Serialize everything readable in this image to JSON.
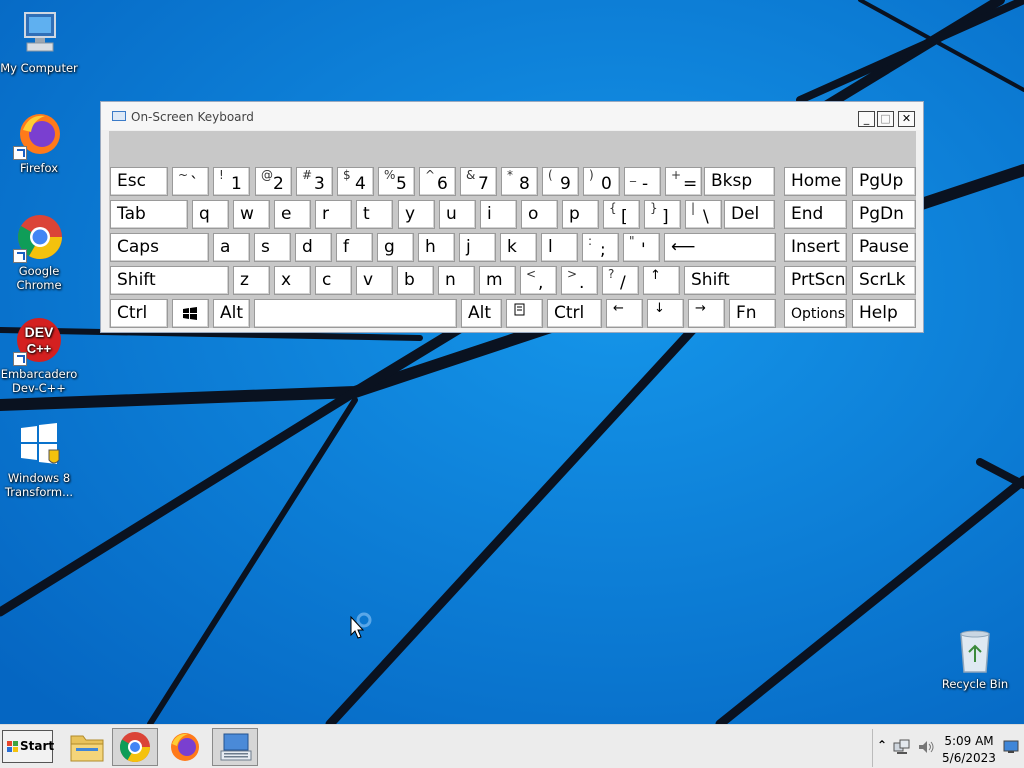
{
  "desktop_icons": [
    {
      "label": "My Computer",
      "icon": "computer-icon"
    },
    {
      "label": "Firefox",
      "icon": "firefox-icon"
    },
    {
      "label": "Google Chrome",
      "icon": "chrome-icon"
    },
    {
      "label": "Embarcadero Dev-C++",
      "icon": "devcpp-icon"
    },
    {
      "label": "Windows 8 Transform...",
      "icon": "windows-logo-icon"
    },
    {
      "label": "Recycle Bin",
      "icon": "recycle-bin-icon"
    }
  ],
  "osk": {
    "title": "On-Screen Keyboard",
    "minimize": "_",
    "maximize": "□",
    "close": "✕",
    "rows": [
      [
        {
          "label": "Esc"
        },
        {
          "alt": "~",
          "label": "`"
        },
        {
          "alt": "!",
          "label": "1"
        },
        {
          "alt": "@",
          "label": "2"
        },
        {
          "alt": "#",
          "label": "3"
        },
        {
          "alt": "$",
          "label": "4"
        },
        {
          "alt": "%",
          "label": "5"
        },
        {
          "alt": "^",
          "label": "6"
        },
        {
          "alt": "&",
          "label": "7"
        },
        {
          "alt": "*",
          "label": "8"
        },
        {
          "alt": "(",
          "label": "9"
        },
        {
          "alt": ")",
          "label": "0"
        },
        {
          "alt": "_",
          "label": "-"
        },
        {
          "alt": "+",
          "label": "="
        },
        {
          "label": "Bksp"
        },
        {
          "label": "Home"
        },
        {
          "label": "PgUp"
        }
      ],
      [
        {
          "label": "Tab"
        },
        {
          "label": "q"
        },
        {
          "label": "w"
        },
        {
          "label": "e"
        },
        {
          "label": "r"
        },
        {
          "label": "t"
        },
        {
          "label": "y"
        },
        {
          "label": "u"
        },
        {
          "label": "i"
        },
        {
          "label": "o"
        },
        {
          "label": "p"
        },
        {
          "alt": "{",
          "label": "["
        },
        {
          "alt": "}",
          "label": "]"
        },
        {
          "alt": "|",
          "label": "\\"
        },
        {
          "label": "Del"
        },
        {
          "label": "End"
        },
        {
          "label": "PgDn"
        }
      ],
      [
        {
          "label": "Caps"
        },
        {
          "label": "a"
        },
        {
          "label": "s"
        },
        {
          "label": "d"
        },
        {
          "label": "f"
        },
        {
          "label": "g"
        },
        {
          "label": "h"
        },
        {
          "label": "j"
        },
        {
          "label": "k"
        },
        {
          "label": "l"
        },
        {
          "alt": ":",
          "label": ";"
        },
        {
          "alt": "\"",
          "label": "'"
        },
        {
          "label": "⟵"
        },
        {
          "label": "Insert"
        },
        {
          "label": "Pause"
        }
      ],
      [
        {
          "label": "Shift"
        },
        {
          "label": "z"
        },
        {
          "label": "x"
        },
        {
          "label": "c"
        },
        {
          "label": "v"
        },
        {
          "label": "b"
        },
        {
          "label": "n"
        },
        {
          "label": "m"
        },
        {
          "alt": "<",
          "label": ","
        },
        {
          "alt": ">",
          "label": "."
        },
        {
          "alt": "?",
          "label": "/"
        },
        {
          "label": "↑"
        },
        {
          "label": "Shift"
        },
        {
          "label": "PrtScn"
        },
        {
          "label": "ScrLk"
        }
      ],
      [
        {
          "label": "Ctrl"
        },
        {
          "label": "",
          "icon": "windows-key-icon"
        },
        {
          "label": "Alt"
        },
        {
          "label": ""
        },
        {
          "label": "Alt"
        },
        {
          "label": "",
          "icon": "menu-key-icon"
        },
        {
          "label": "Ctrl"
        },
        {
          "label": "←"
        },
        {
          "label": "↓"
        },
        {
          "label": "→"
        },
        {
          "label": "Fn"
        },
        {
          "label": "Options"
        },
        {
          "label": "Help"
        }
      ]
    ]
  },
  "taskbar": {
    "start_label": "Start",
    "pinned": [
      {
        "name": "file-explorer-icon",
        "active": false
      },
      {
        "name": "chrome-icon",
        "active": true
      },
      {
        "name": "firefox-icon",
        "active": false
      },
      {
        "name": "on-screen-keyboard-icon",
        "active": true
      }
    ],
    "tray": {
      "time": "5:09 AM",
      "date": "5/6/2023",
      "icons": [
        "chevron-up-icon",
        "network-icon",
        "volume-icon",
        "show-desktop-icon"
      ]
    }
  },
  "colors": {
    "wallpaper": "#0a7fd6",
    "wallpaper_dark": "#0564b8",
    "line": "#0a1220",
    "key_face": "#ffffff",
    "osk_panel": "#c8c8c8"
  }
}
